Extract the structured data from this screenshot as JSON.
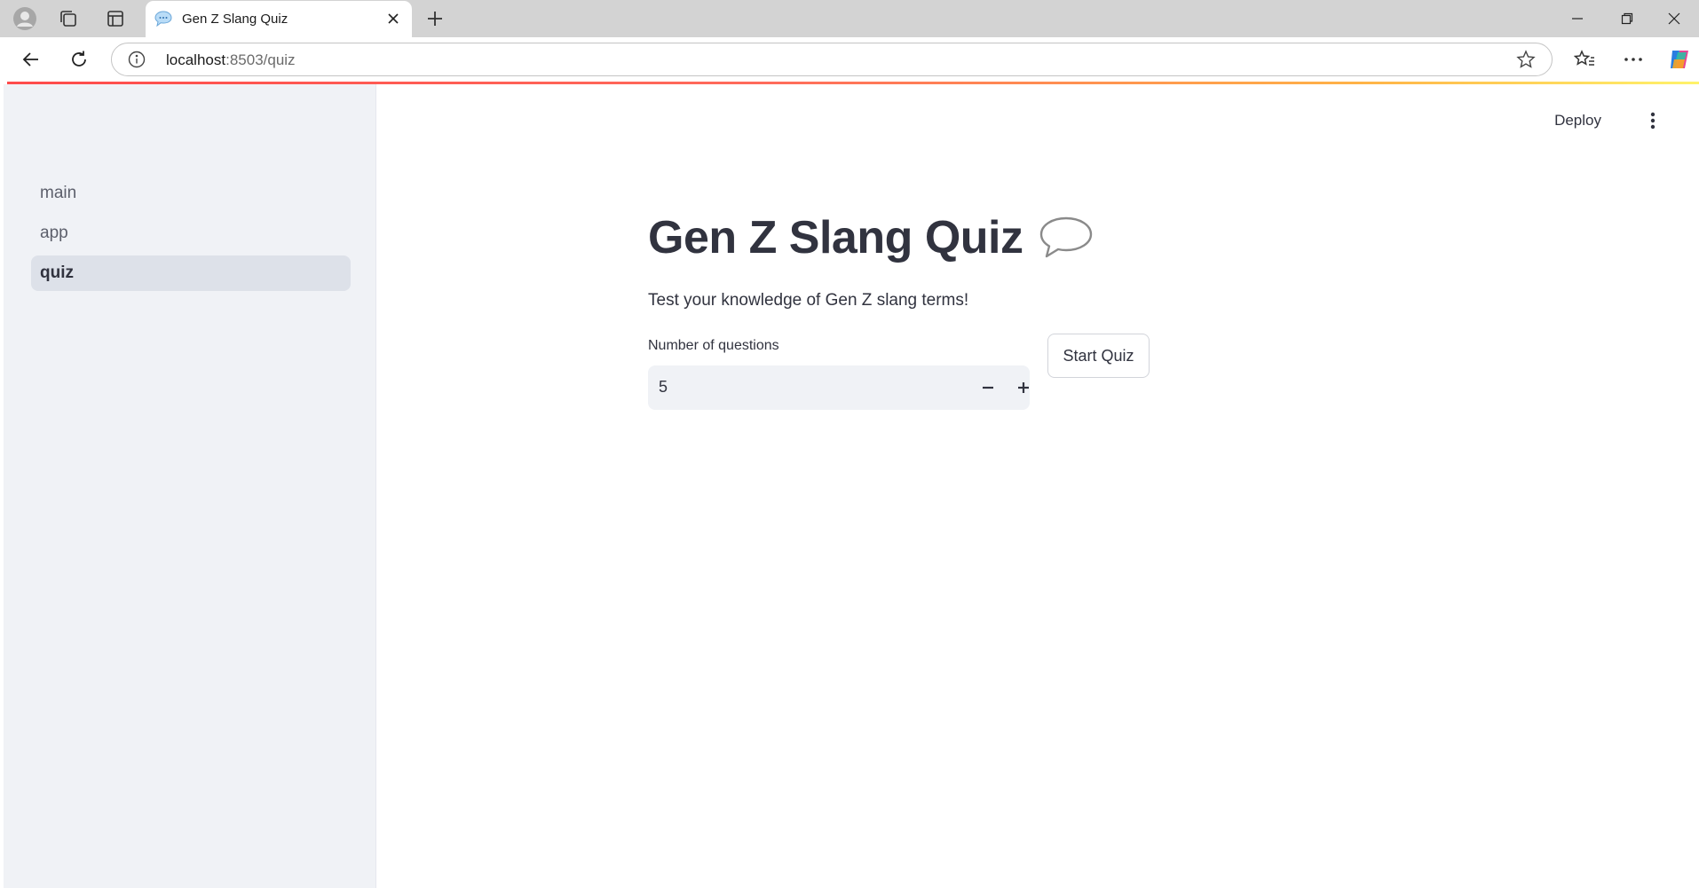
{
  "browser": {
    "tab_title": "Gen Z Slang Quiz",
    "url_host": "localhost",
    "url_rest": ":8503/quiz"
  },
  "sidebar": {
    "items": [
      {
        "label": "main",
        "active": false
      },
      {
        "label": "app",
        "active": false
      },
      {
        "label": "quiz",
        "active": true
      }
    ]
  },
  "header": {
    "deploy_label": "Deploy"
  },
  "main": {
    "title": "Gen Z Slang Quiz",
    "title_icon": "speech-balloon-icon",
    "subtitle": "Test your knowledge of Gen Z slang terms!",
    "number_input": {
      "label": "Number of questions",
      "value": "5"
    },
    "start_button_label": "Start Quiz"
  },
  "colors": {
    "accent": "#ff4b4b",
    "sidebar_bg": "#f0f2f6",
    "active_item_bg": "#dde1e9",
    "text": "#31333f"
  }
}
